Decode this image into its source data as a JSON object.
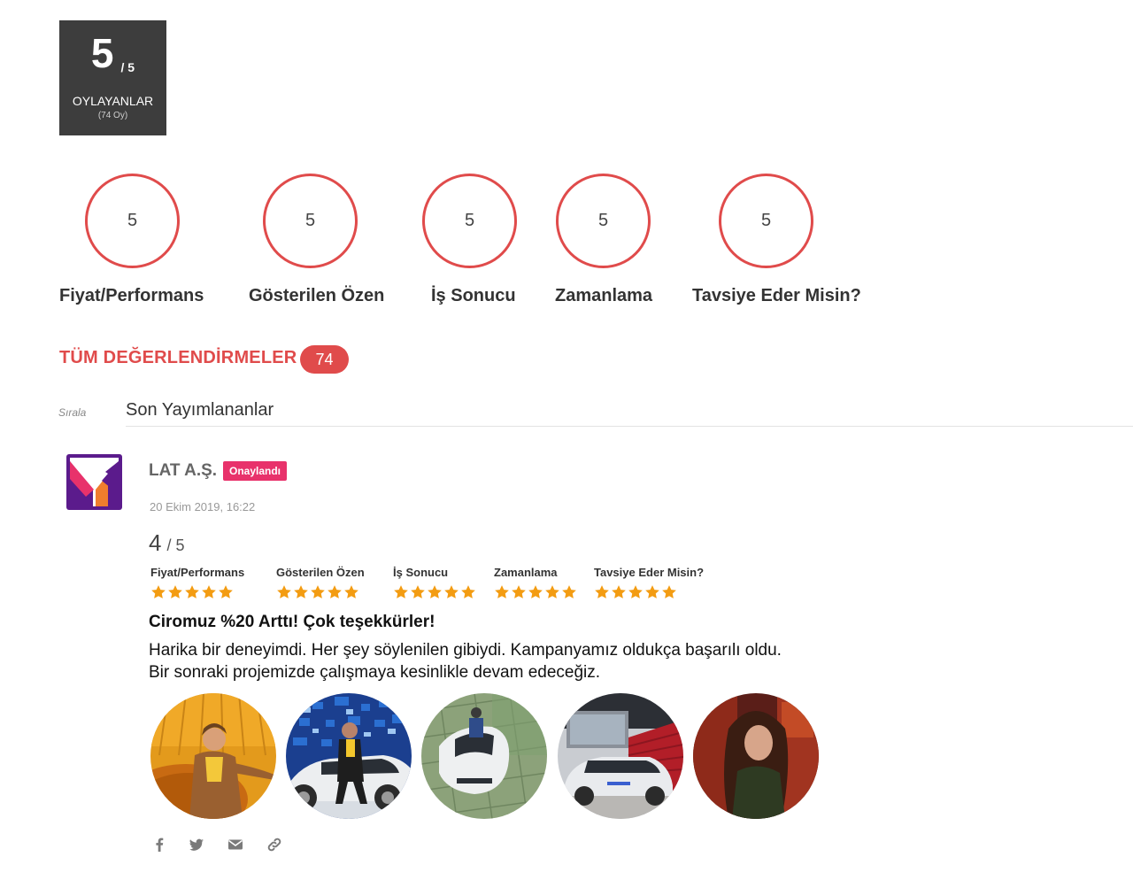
{
  "overall": {
    "score": "5",
    "out_of": "/ 5",
    "label": "OYLAYANLAR",
    "votes": "(74 Oy)"
  },
  "criteria": [
    {
      "label": "Fiyat/Performans",
      "score": "5"
    },
    {
      "label": "Gösterilen Özen",
      "score": "5"
    },
    {
      "label": "İş Sonucu",
      "score": "5"
    },
    {
      "label": "Zamanlama",
      "score": "5"
    },
    {
      "label": "Tavsiye Eder Misin?",
      "score": "5"
    }
  ],
  "reviews_header": {
    "title": "TÜM DEĞERLENDİRMELER",
    "count": "74"
  },
  "sort": {
    "label": "Sırala",
    "value": "Son Yayımlananlar"
  },
  "review": {
    "company": "LAT A.Ş.",
    "badge": "Onaylandı",
    "date": "20 Ekim 2019, 16:22",
    "score": "4",
    "out_of": "/ 5",
    "criteria": [
      {
        "label": "Fiyat/Performans",
        "stars": 5
      },
      {
        "label": "Gösterilen Özen",
        "stars": 5
      },
      {
        "label": "İş Sonucu",
        "stars": 5
      },
      {
        "label": "Zamanlama",
        "stars": 5
      },
      {
        "label": "Tavsiye Eder Misin?",
        "stars": 5
      }
    ],
    "title": "Ciromuz %20 Arttı! Çok teşekkürler!",
    "text_line1": "Harika bir deneyimdi. Her şey söylenilen gibiydi. Kampanyamız oldukça başarılı oldu.",
    "text_line2": "Bir sonraki projemizde çalışmaya kesinlikle devam edeceğiz.",
    "photos": [
      "photo-1",
      "photo-2",
      "photo-3",
      "photo-4",
      "photo-5"
    ],
    "share_icons": [
      "facebook-icon",
      "twitter-icon",
      "mail-icon",
      "link-icon"
    ]
  },
  "colors": {
    "accent": "#e04b4b",
    "badge": "#e8326b",
    "star": "#f39c12",
    "score_box": "#3d3d3d"
  }
}
